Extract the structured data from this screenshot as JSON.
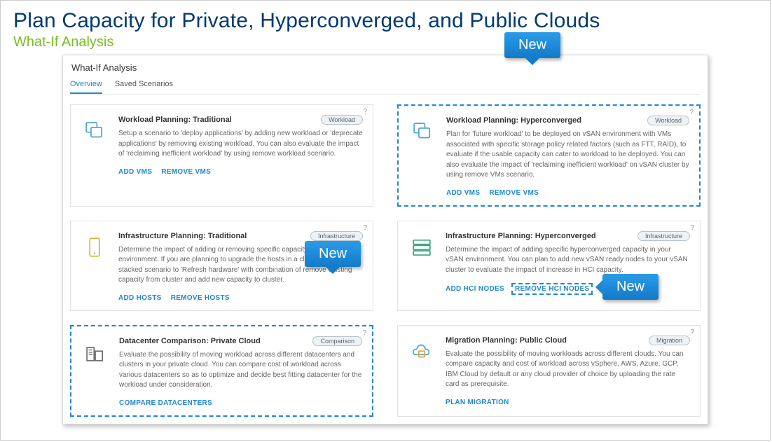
{
  "page": {
    "title": "Plan Capacity for Private, Hyperconverged, and Public Clouds",
    "subtitle": "What-If Analysis"
  },
  "panel": {
    "title": "What-If Analysis",
    "tabs": {
      "overview": "Overview",
      "saved": "Saved Scenarios"
    }
  },
  "callouts": {
    "new": "New"
  },
  "cards": {
    "wp_trad": {
      "title": "Workload Planning: Traditional",
      "badge": "Workload",
      "desc": "Setup a scenario to 'deploy applications' by adding new workload or 'deprecate applications' by removing existing workload. You can also evaluate the impact of 'reclaiming inefficient workload' by using remove workload scenario.",
      "a1": "ADD VMS",
      "a2": "REMOVE VMS"
    },
    "wp_hci": {
      "title": "Workload Planning: Hyperconverged",
      "badge": "Workload",
      "desc": "Plan for 'future workload' to be deployed on vSAN environment with VMs associated with specific storage policy related factors (such as FTT, RAID), to evaluate if the usable capacity can cater to workload to be deployed. You can also evaluate the impact of 'reclaiming inefficient workload' on vSAN cluster by using remove VMs scenario.",
      "a1": "ADD VMS",
      "a2": "REMOVE VMS"
    },
    "ip_trad": {
      "title": "Infrastructure Planning: Traditional",
      "badge": "Infrastructure",
      "desc": "Determine the impact of adding or removing specific capacity in your environment. If you are planning to upgrade the hosts in a cluster, setup a stacked scenario to 'Refresh hardware' with combination of remove existing capacity from cluster and add new capacity to cluster.",
      "a1": "ADD HOSTS",
      "a2": "REMOVE HOSTS"
    },
    "ip_hci": {
      "title": "Infrastructure Planning: Hyperconverged",
      "badge": "Infrastructure",
      "desc": "Determine the impact of adding specific hyperconverged capacity in your vSAN environment. You can plan to add new vSAN ready nodes to your vSAN cluster to evaluate the impact of increase in HCI capacity.",
      "a1": "ADD HCI NODES",
      "a2": "REMOVE HCI NODES"
    },
    "dc_comp": {
      "title": "Datacenter Comparison: Private Cloud",
      "badge": "Comparison",
      "desc": "Evaluate the possibility of moving workload across different datacenters and clusters in your private cloud. You can compare cost of workload across various datacenters so as to optimize and decide best fitting datacenter for the workload under consideration.",
      "a1": "COMPARE DATACENTERS"
    },
    "mig": {
      "title": "Migration Planning: Public Cloud",
      "badge": "Migration",
      "desc": "Evaluate the possibility of moving workloads across different clouds. You can compare capacity and cost of workload across vSphere, AWS, Azure, GCP, IBM Cloud by default or any cloud provider of choice by uploading the rate card as prerequisite.",
      "a1": "PLAN MIGRATION"
    }
  }
}
